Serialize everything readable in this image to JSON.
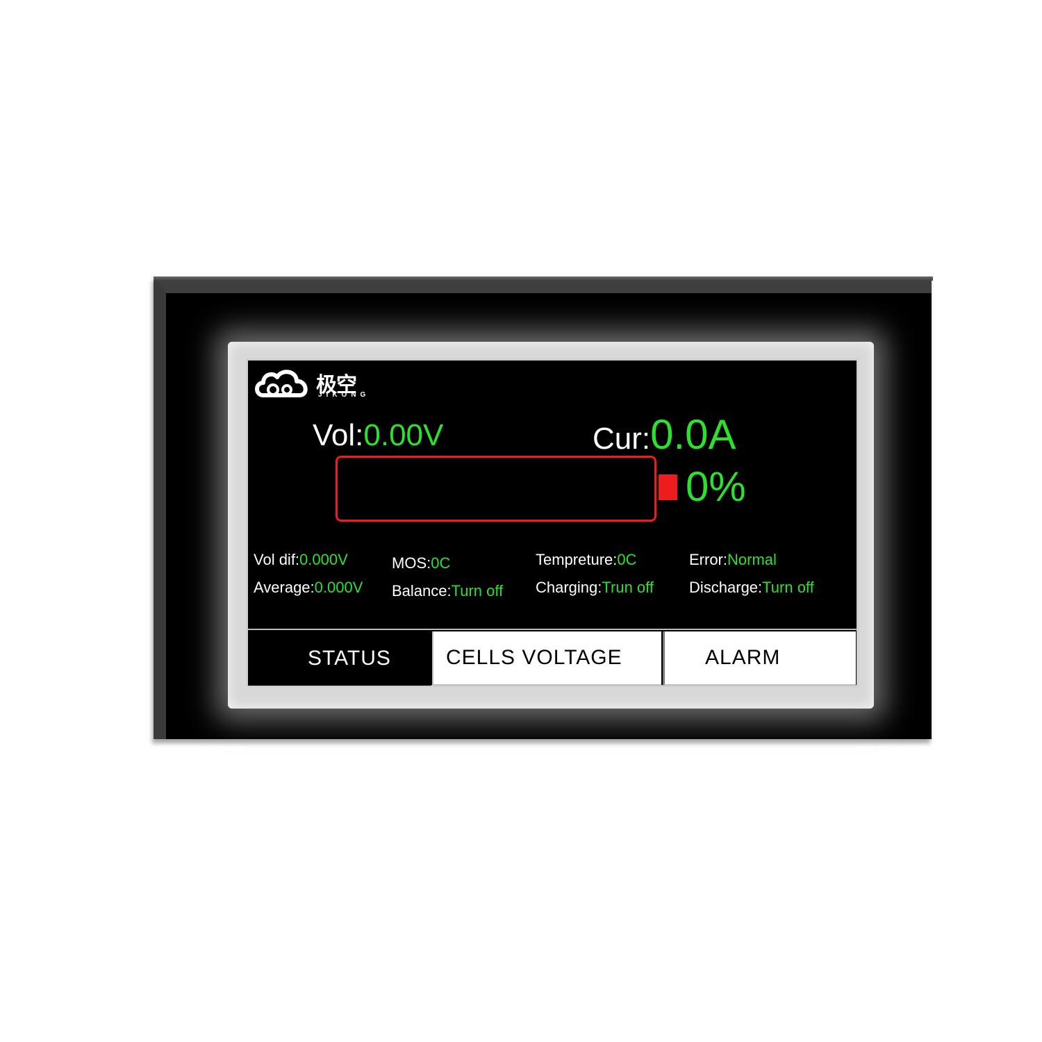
{
  "logo": {
    "brand": "极空",
    "sub": "JIKONG"
  },
  "main": {
    "vol_label": "Vol:",
    "vol_value": "0.00V",
    "cur_label": "Cur:",
    "cur_value": "0.0A",
    "soc": "0%",
    "soc_fraction": 0
  },
  "stats": {
    "vol_dif_label": "Vol dif:",
    "vol_dif_value": "0.000V",
    "average_label": "Average:",
    "average_value": "0.000V",
    "mos_label": "MOS:",
    "mos_value": "0C",
    "balance_label": "Balance:",
    "balance_value": "Turn off",
    "temp_label": "Tempreture:",
    "temp_value": "0C",
    "charging_label": "Charging:",
    "charging_value": "Trun off",
    "error_label": "Error:",
    "error_value": "Normal",
    "discharge_label": "Discharge:",
    "discharge_value": "Turn off"
  },
  "tabs": {
    "status": "STATUS",
    "cells": "CELLS VOLTAGE",
    "alarm": "ALARM"
  },
  "colors": {
    "value": "#2ee02e",
    "battery_outline": "#ee1c1c"
  }
}
